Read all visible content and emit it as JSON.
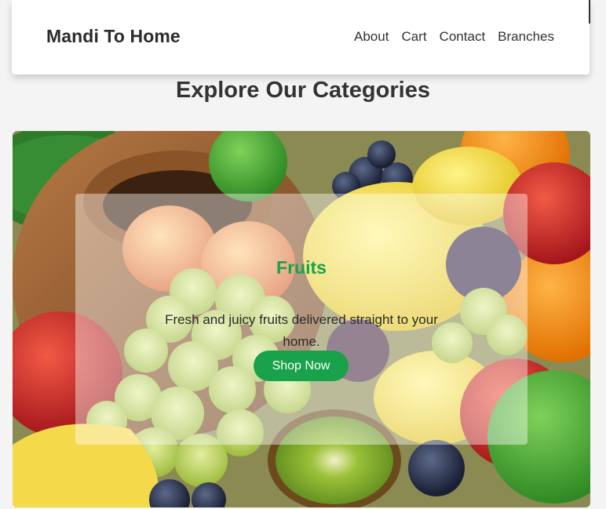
{
  "header": {
    "brand": "Mandi To Home",
    "nav": [
      "About",
      "Cart",
      "Contact",
      "Branches"
    ]
  },
  "section": {
    "title": "Explore Our Categories"
  },
  "category": {
    "title": "Fruits",
    "description": "Fresh and juicy fruits delivered straight to your home.",
    "button_label": "Shop Now",
    "image_icon": "fruit-basket-photo"
  },
  "colors": {
    "accent": "#1aa14c",
    "title_green": "#18a24a",
    "page_bg": "#f4f4f4"
  }
}
